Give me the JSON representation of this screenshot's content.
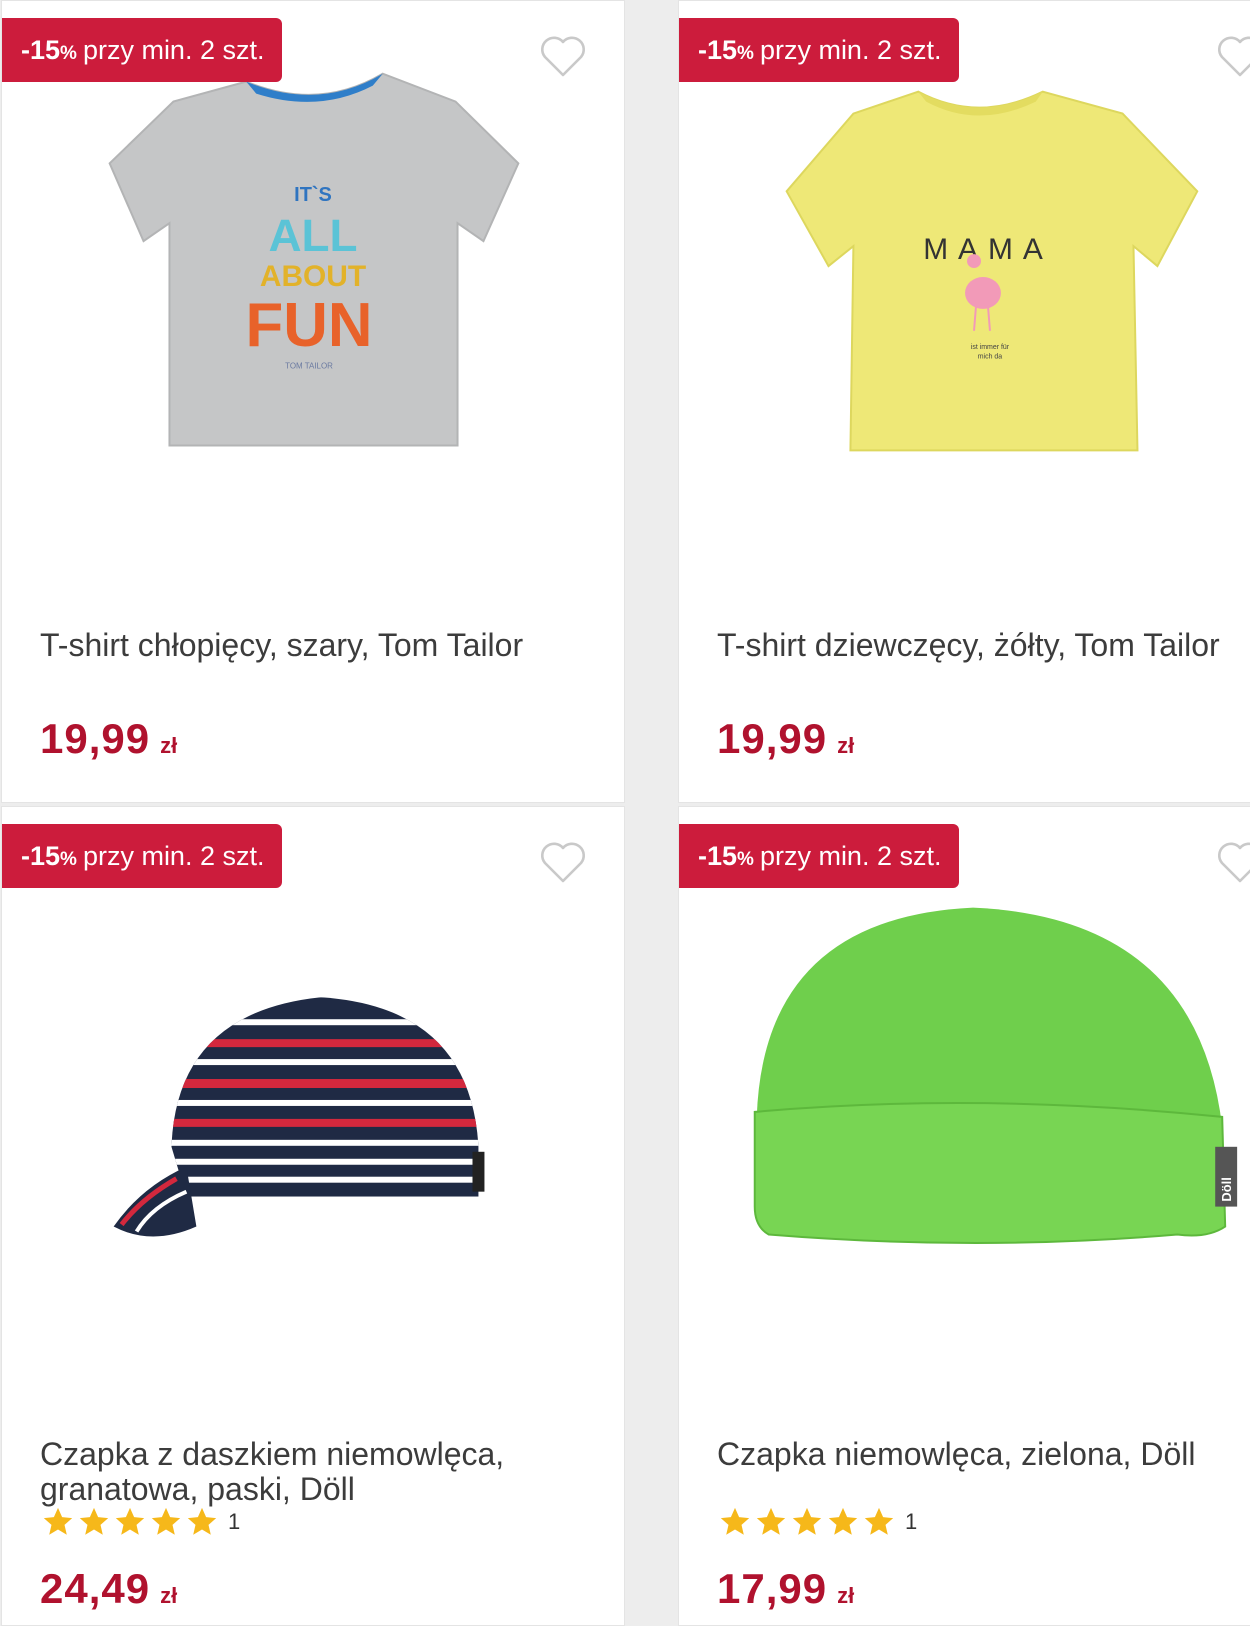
{
  "products": [
    {
      "promo_percent": "-15",
      "promo_percent_sign": "%",
      "promo_text": "przy min. 2 szt.",
      "title": "T-shirt chłopięcy, szary, Tom Tailor",
      "price": "19,99",
      "currency": "zł",
      "print_lines": [
        "IT`S",
        "ALL",
        "ABOUT",
        "FUN",
        "TOM TAILOR"
      ]
    },
    {
      "promo_percent": "-15",
      "promo_percent_sign": "%",
      "promo_text": "przy min. 2 szt.",
      "title": "T-shirt dziewczęcy, żółty, Tom Tailor",
      "price": "19,99",
      "currency": "zł",
      "print_lines": [
        "MAMA",
        "ist immer für",
        "mich da"
      ]
    },
    {
      "promo_percent": "-15",
      "promo_percent_sign": "%",
      "promo_text": "przy min. 2 szt.",
      "title": "Czapka z daszkiem niemowlęca,\ngranatowa, paski, Döll",
      "rating_value": 5,
      "rating_count": "1",
      "price": "24,49",
      "currency": "zł"
    },
    {
      "promo_percent": "-15",
      "promo_percent_sign": "%",
      "promo_text": "przy min. 2 szt.",
      "title": "Czapka niemowlęca, zielona, Döll",
      "rating_value": 5,
      "rating_count": "1",
      "price": "17,99",
      "currency": "zł",
      "label_text": "Döll"
    }
  ],
  "colors": {
    "promo_bg": "#cc1c3c",
    "price": "#b0122e",
    "star": "#f6b81a"
  }
}
